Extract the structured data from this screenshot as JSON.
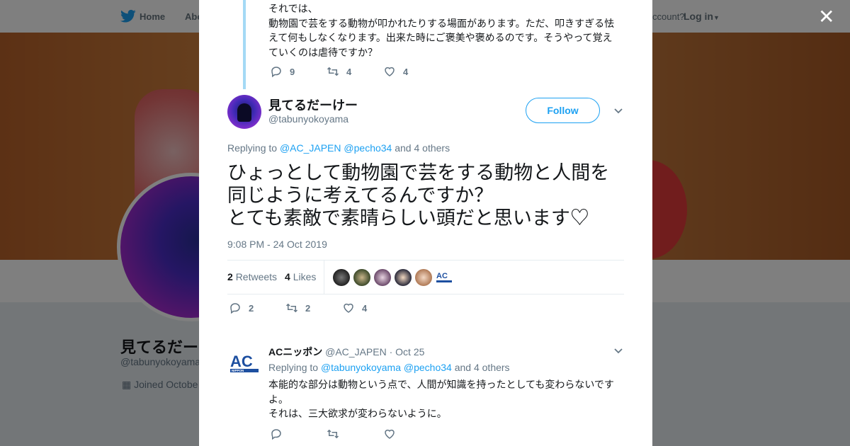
{
  "background": {
    "nav": {
      "home": "Home",
      "about": "Abo",
      "account": "ccount?",
      "login": "Log in"
    },
    "profile": {
      "name": "見てるだーけ",
      "handle": "@tabunyokoyama",
      "joined": "Joined Octobe"
    }
  },
  "previous_tweet": {
    "lines": [
      "それでは、",
      "動物園で芸をする動物が叩かれたりする場面があります。ただ、叩きすぎる怯えて何もしなくなります。出来た時にご褒美や褒めるのです。そうやって覚えていくのは虐待ですか？"
    ],
    "replies": "9",
    "retweets": "4",
    "likes": "4"
  },
  "main_tweet": {
    "name": "見てるだーけー",
    "handle": "@tabunyokoyama",
    "follow_label": "Follow",
    "replying_prefix": "Replying to",
    "reply_to_1": "@AC_JAPEN",
    "reply_to_2": "@pecho34",
    "replying_suffix": "and 4 others",
    "text_lines": [
      "ひょっとして動物園で芸をする動物と人間を",
      "同じように考えてるんですか？",
      "とても素敵で素晴らしい頭だと思います♡"
    ],
    "timestamp": "9:08 PM - 24 Oct 2019",
    "retweet_count": "2",
    "retweet_label": "Retweets",
    "like_count": "4",
    "like_label": "Likes",
    "replies": "2",
    "retweets": "2",
    "likes": "4"
  },
  "reply_tweet": {
    "name": "ACニッポン",
    "handle": "@AC_JAPEN",
    "date": "· Oct 25",
    "replying_prefix": "Replying to",
    "reply_to_1": "@tabunyokoyama",
    "reply_to_2": "@pecho34",
    "replying_suffix": "and 4 others",
    "lines": [
      "本能的な部分は動物という点で、人間が知識を持ったとしても変わらないですよ。",
      "それは、三大欲求が変わらないように。"
    ]
  },
  "colors": {
    "accent": "#1da1f2",
    "thread": "#a4d9f5",
    "muted": "#657786",
    "text": "#14171a"
  },
  "icons": [
    "twitter-bird-icon",
    "close-icon",
    "reply-icon",
    "retweet-icon",
    "like-icon",
    "chevron-down-icon",
    "calendar-icon",
    "ac-nippon-logo"
  ]
}
